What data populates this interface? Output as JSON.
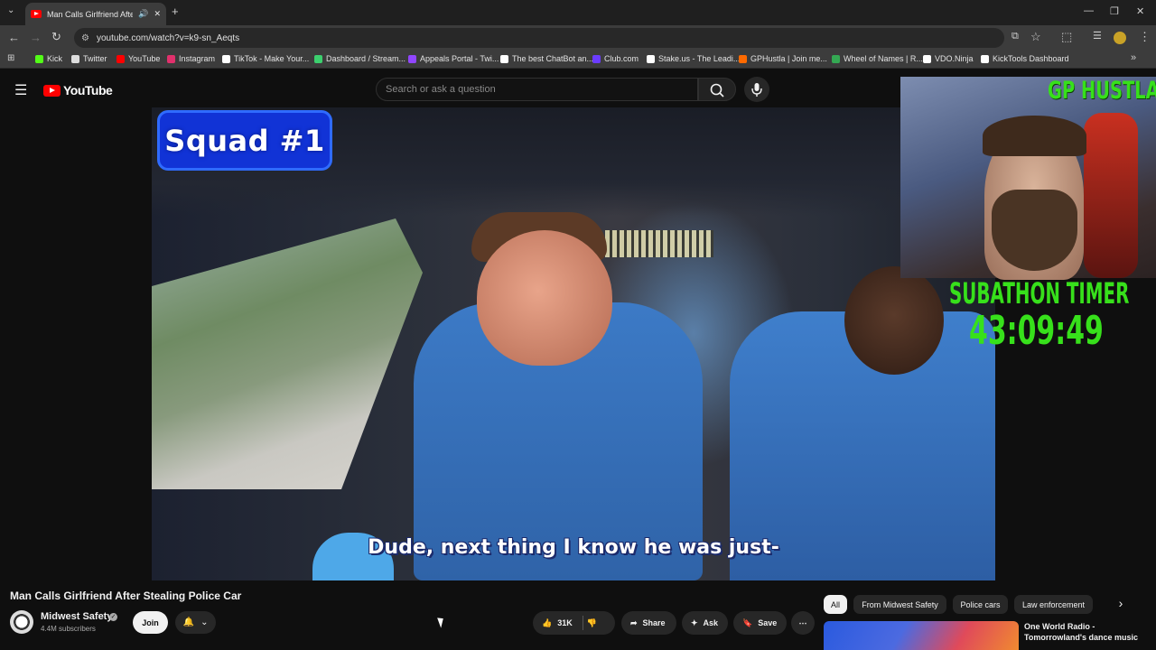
{
  "browser": {
    "tab_title": "Man Calls Girlfriend After St",
    "url": "youtube.com/watch?v=k9-sn_Aeqts",
    "bookmarks": [
      {
        "label": "Kick",
        "color": "#53fc18"
      },
      {
        "label": "Twitter",
        "color": "#dddddd"
      },
      {
        "label": "YouTube",
        "color": "#ff0000"
      },
      {
        "label": "Instagram",
        "color": "#e1306c"
      },
      {
        "label": "TikTok - Make Your...",
        "color": "#ffffff"
      },
      {
        "label": "Dashboard / Stream...",
        "color": "#3ccf6e"
      },
      {
        "label": "Appeals Portal - Twi...",
        "color": "#9146ff"
      },
      {
        "label": "The best ChatBot an...",
        "color": "#ffffff"
      },
      {
        "label": "Club.com",
        "color": "#6b3cff"
      },
      {
        "label": "Stake.us - The Leadi...",
        "color": "#ffffff"
      },
      {
        "label": "GPHustla | Join me...",
        "color": "#ff6a00"
      },
      {
        "label": "Wheel of Names | R...",
        "color": "#34a853"
      },
      {
        "label": "VDO.Ninja",
        "color": "#ffffff"
      },
      {
        "label": "KickTools Dashboard",
        "color": "#ffffff"
      }
    ]
  },
  "youtube": {
    "logo_text": "YouTube",
    "search_placeholder": "Search or ask a question"
  },
  "video": {
    "badge_text": "Squad #1",
    "caption": "Dude, next thing I know he was just-"
  },
  "overlay": {
    "streamer_name": "GP HUSTLA",
    "timer_label": "SUBATHON TIMER",
    "timer_value": "43:09:49"
  },
  "meta": {
    "title": "Man Calls Girlfriend After Stealing Police Car",
    "channel_name": "Midwest Safety",
    "subscribers": "4.4M subscribers",
    "join_label": "Join",
    "like_count": "31K",
    "share_label": "Share",
    "ask_label": "Ask",
    "save_label": "Save"
  },
  "chips": [
    "All",
    "From Midwest Safety",
    "Police cars",
    "Law enforcement"
  ],
  "recommendation": {
    "title": "One World Radio - Tomorrowland's dance music"
  }
}
